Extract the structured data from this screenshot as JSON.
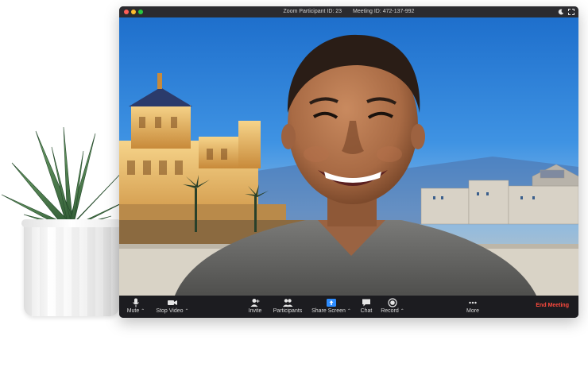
{
  "window": {
    "participant_id_label": "Zoom Participant ID: 23",
    "meeting_id_label": "Meeting ID: 472-137-992"
  },
  "toolbar": {
    "mute_label": "Mute",
    "stop_video_label": "Stop Video",
    "invite_label": "Invite",
    "participants_label": "Participants",
    "share_screen_label": "Share Screen",
    "chat_label": "Chat",
    "record_label": "Record",
    "more_label": "More",
    "end_meeting_label": "End Meeting"
  },
  "colors": {
    "end_meeting": "#ff4a3d",
    "share_accent": "#2d8cff",
    "toolbar_bg": "#1c1c20"
  },
  "icons": {
    "mute": "microphone-icon",
    "stop_video": "camera-icon",
    "invite": "add-person-icon",
    "participants": "people-icon",
    "share_screen": "share-screen-icon",
    "chat": "chat-bubble-icon",
    "record": "record-icon",
    "more": "more-dots-icon",
    "moon": "moon-icon",
    "fullscreen": "fullscreen-icon"
  }
}
